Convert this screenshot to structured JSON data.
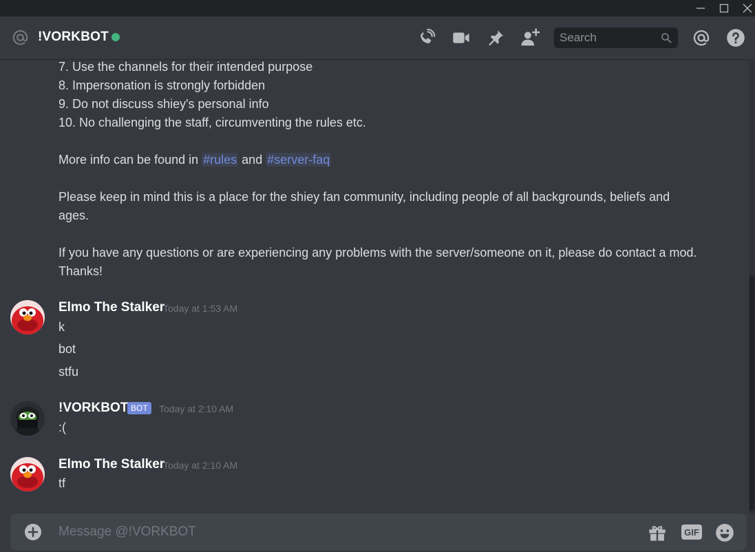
{
  "window": {
    "controls": [
      "minimize",
      "maximize",
      "close"
    ]
  },
  "header": {
    "title": "!VORKBOT",
    "status_color": "#43b581",
    "icons": [
      "at-icon",
      "phone-call-icon",
      "video-call-icon",
      "pin-icon",
      "add-user-icon",
      "mention-icon",
      "help-icon"
    ],
    "search_placeholder": "Search"
  },
  "rules_message": {
    "rules": [
      "7. Use the channels for their intended purpose",
      "8. Impersonation is strongly forbidden",
      "9. Do not discuss shiey's personal info",
      "10. No challenging the staff, circumventing the rules etc."
    ],
    "more_info_prefix": "More info can be found in ",
    "channel_rules": "#rules",
    "and": " and ",
    "channel_faq": "#server-faq",
    "community_note": "Please keep in mind this is a place for the shiey fan community, including people of all backgrounds, beliefs and ages.",
    "contact_note": "If you have any questions or are experiencing any problems with the server/someone on it, please do contact a mod. Thanks!"
  },
  "messages": [
    {
      "author": "Elmo The Stalker",
      "timestamp": "Today at 1:53 AM",
      "lines": [
        "k",
        "bot",
        "stfu"
      ]
    },
    {
      "author": "!VORKBOT",
      "bot_tag": "BOT",
      "timestamp": "Today at 2:10 AM",
      "lines": [
        ":("
      ]
    },
    {
      "author": "Elmo The Stalker",
      "timestamp": "Today at 2:10 AM",
      "lines": [
        "tf"
      ]
    }
  ],
  "composer": {
    "placeholder": "Message @!VORKBOT",
    "gif_label": "GIF",
    "icons": [
      "add-attachment-icon",
      "gift-icon",
      "gif-icon",
      "emoji-icon"
    ]
  },
  "colors": {
    "background": "#36393f",
    "titlebar": "#202225",
    "accent": "#7289da",
    "online": "#43b581",
    "composer": "#40444b"
  }
}
